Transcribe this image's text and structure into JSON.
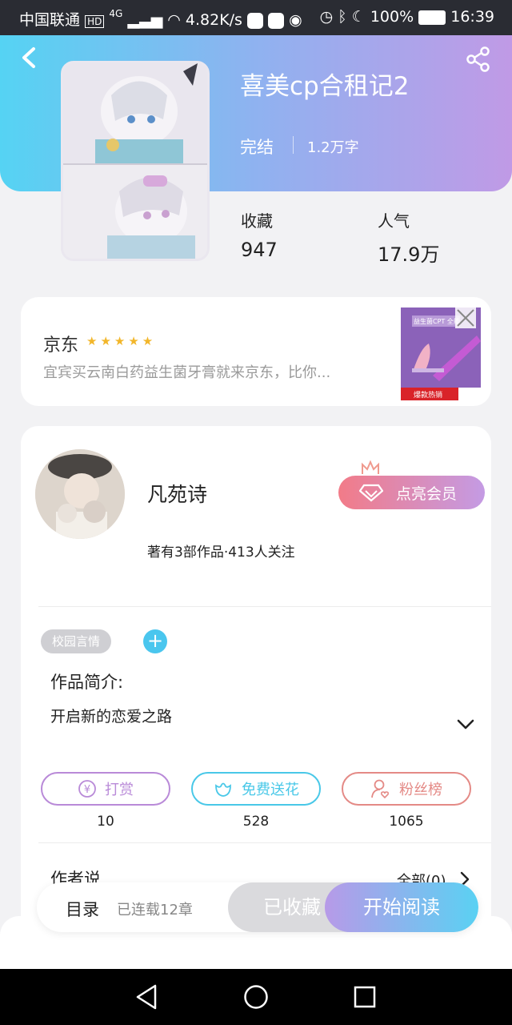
{
  "status_bar": {
    "carrier": "中国联通",
    "network": "4G",
    "speed": "4.82K/s",
    "battery": "100%",
    "time": "16:39"
  },
  "book": {
    "title": "喜美cp合租记2",
    "status": "完结",
    "word_count": "1.2万字",
    "favorites_label": "收藏",
    "favorites_value": "947",
    "popularity_label": "人气",
    "popularity_value": "17.9万"
  },
  "ad": {
    "brand": "京东",
    "rating_stars": 5,
    "text": "宜宾买云南白药益生菌牙膏就来京东，比你...",
    "product_badge": "爆款热销",
    "product_label": "益生菌CPT 全能"
  },
  "author": {
    "name": "凡苑诗",
    "stats": "著有3部作品·413人关注",
    "vip_button": "点亮会员"
  },
  "tags": [
    "校园言情"
  ],
  "intro": {
    "heading": "作品简介:",
    "text": "开启新的恋爱之路"
  },
  "actions": [
    {
      "label": "打赏",
      "count": "10",
      "color": "#b98ad8"
    },
    {
      "label": "免费送花",
      "count": "528",
      "color": "#49c8e8"
    },
    {
      "label": "粉丝榜",
      "count": "1065",
      "color": "#e48a86"
    }
  ],
  "author_says": {
    "heading": "作者说",
    "all": "全部(0)"
  },
  "bottom_bar": {
    "catalog": "目录",
    "chapters": "已连载12章",
    "collected": "已收藏",
    "read": "开始阅读"
  }
}
